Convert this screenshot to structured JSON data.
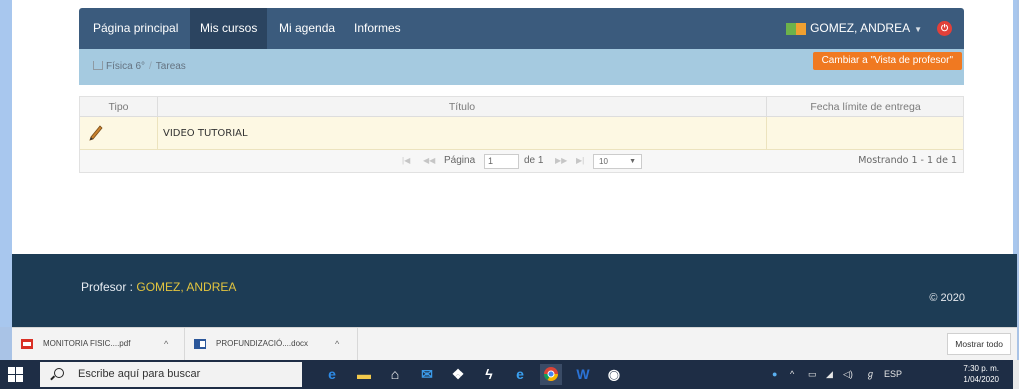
{
  "navbar": {
    "items": [
      {
        "label": "Página principal",
        "active": false
      },
      {
        "label": "Mis cursos",
        "active": true
      },
      {
        "label": "Mi agenda",
        "active": false
      },
      {
        "label": "Informes",
        "active": false
      }
    ],
    "user": "GOMEZ, ANDREA"
  },
  "breadcrumb": {
    "course": "Física 6°",
    "separator": "/",
    "page": "Tareas",
    "switch_button": "Cambiar a \"Vista de profesor\""
  },
  "grid": {
    "columns": [
      "Tipo",
      "Título",
      "Fecha límite de entrega"
    ],
    "rows": [
      {
        "type_icon": "pencil-icon",
        "title": "VIDEO TUTORIAL",
        "due": ""
      }
    ],
    "pager": {
      "page_label": "Página",
      "page_value": "1",
      "of_label": "de 1",
      "page_size": "10",
      "showing": "Mostrando 1 - 1 de 1"
    }
  },
  "footer": {
    "teacher_label": "Profesor :",
    "teacher_name": "GOMEZ, ANDREA",
    "copyright": "© 2020"
  },
  "downloads": {
    "items": [
      {
        "name": "MONITORIA FISIC....pdf",
        "icon": "pdf-icon"
      },
      {
        "name": "PROFUNDIZACIÓ....docx",
        "icon": "word-icon"
      }
    ],
    "show_all": "Mostrar todo"
  },
  "taskbar": {
    "search_placeholder": "Escribe aquí para buscar",
    "language": "ESP",
    "time": "7:30 p. m.",
    "date": "1/04/2020"
  },
  "colors": {
    "navbar": "#3b5b7d",
    "breadcrumb_bar": "#a5cae0",
    "accent_button": "#f07921",
    "footer": "#1d3c55",
    "teacher_name": "#e2c43f"
  }
}
